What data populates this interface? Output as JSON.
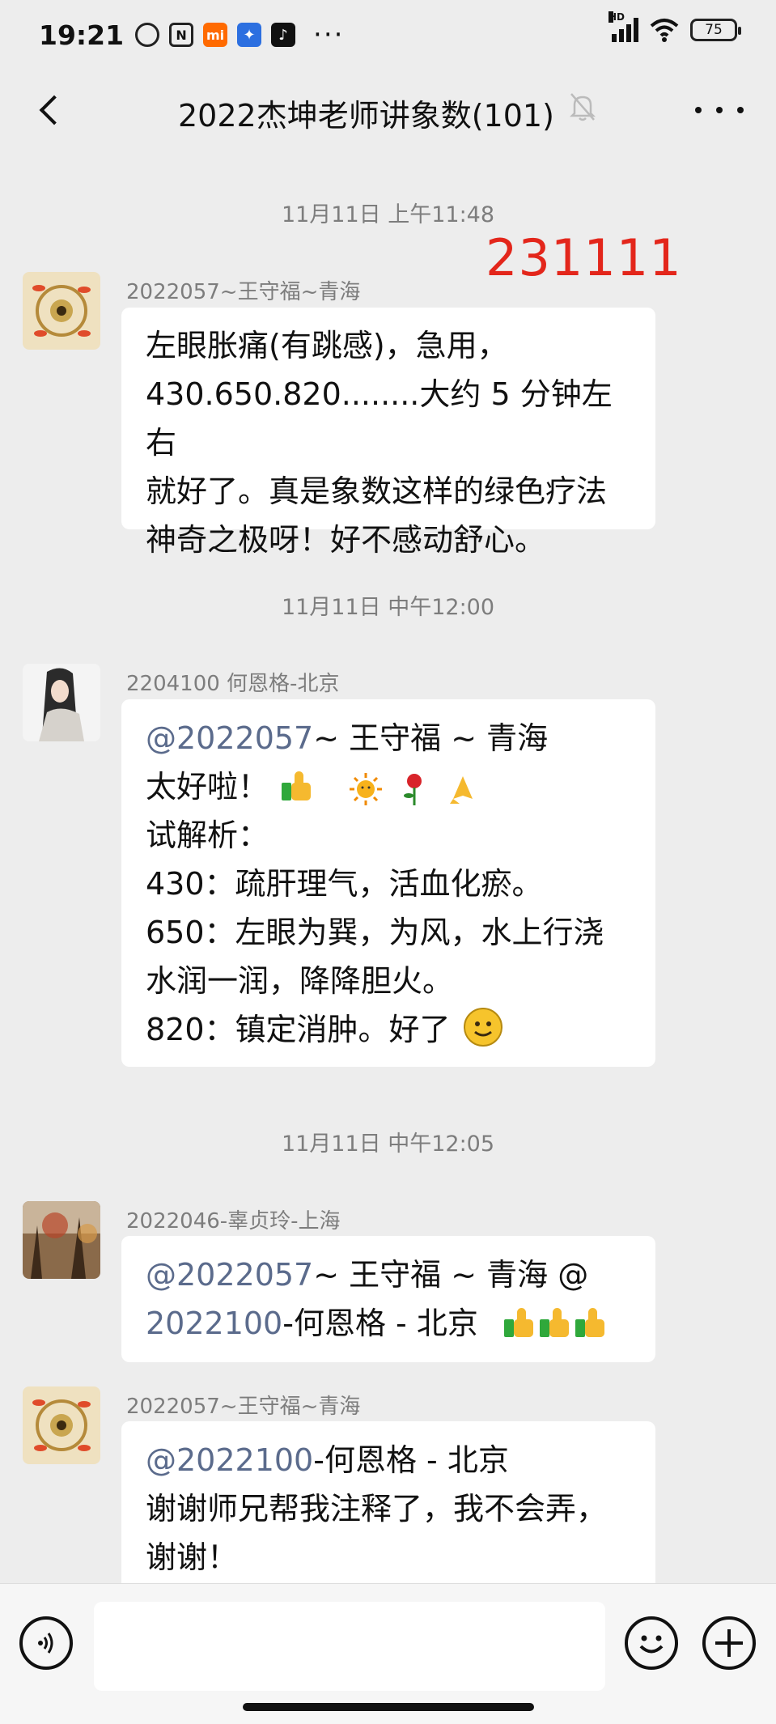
{
  "status_bar": {
    "time": "19:21",
    "icons": [
      "alarm-icon",
      "nfc-icon",
      "mi-icon",
      "bird-app-icon",
      "tiktok-icon"
    ],
    "more": "···",
    "network": "HD",
    "battery": "75"
  },
  "header": {
    "title": "2022杰坤老师讲象数(101)",
    "muted": true
  },
  "annotation": "231111",
  "messages": [
    {
      "timestamp": "11月11日 上午11:48",
      "sender": "2022057~王守福~青海",
      "lines": [
        "左眼胀痛(有跳感)，急用，",
        "430.650.820........大约 5 分钟左右",
        "就好了。真是象数这样的绿色疗法",
        "神奇之极呀！好不感动舒心。"
      ]
    },
    {
      "timestamp": "11月11日 中午12:00",
      "sender": "2204100 何恩格-北京",
      "mention": "@2022057",
      "mention_rest": "~ 王守福 ~ 青海",
      "line2_text": "太好啦！",
      "lines": [
        "试解析：",
        "430：疏肝理气，活血化瘀。",
        "650：左眼为巽，为风，水上行浇",
        "水润一润，降降胆火。",
        "820：镇定消肿。好了"
      ]
    },
    {
      "timestamp": "11月11日 中午12:05",
      "sender": "2022046-辜贞玲-上海",
      "mention1": "@2022057",
      "mention1_rest": "~ 王守福 ~ 青海 @",
      "mention2": "2022100",
      "mention2_rest": "-何恩格 - 北京"
    },
    {
      "sender": "2022057~王守福~青海",
      "mention": "@2022100",
      "mention_rest": "-何恩格 - 北京",
      "lines": [
        "谢谢师兄帮我注释了，我不会弄，",
        "谢谢！"
      ]
    }
  ],
  "input": {
    "placeholder": ""
  }
}
